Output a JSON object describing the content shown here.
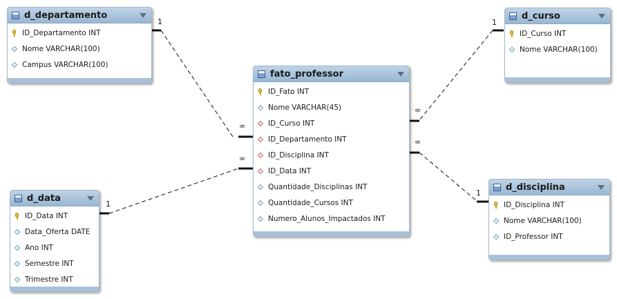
{
  "tables": {
    "d_departamento": {
      "title": "d_departamento",
      "columns": [
        {
          "label": "ID_Departamento INT",
          "kind": "pk"
        },
        {
          "label": "Nome VARCHAR(100)",
          "kind": "attr"
        },
        {
          "label": "Campus VARCHAR(100)",
          "kind": "attr"
        }
      ]
    },
    "d_curso": {
      "title": "d_curso",
      "columns": [
        {
          "label": "ID_Curso INT",
          "kind": "pk"
        },
        {
          "label": "Nome VARCHAR(100)",
          "kind": "attr"
        }
      ]
    },
    "fato_professor": {
      "title": "fato_professor",
      "columns": [
        {
          "label": "ID_Fato INT",
          "kind": "pk"
        },
        {
          "label": "Nome VARCHAR(45)",
          "kind": "attr"
        },
        {
          "label": "ID_Curso INT",
          "kind": "fk"
        },
        {
          "label": "ID_Departamento INT",
          "kind": "fk"
        },
        {
          "label": "ID_Disciplina INT",
          "kind": "fk"
        },
        {
          "label": "ID_Data INT",
          "kind": "fk"
        },
        {
          "label": "Quantidade_Disciplinas INT",
          "kind": "attr"
        },
        {
          "label": "Quantidade_Cursos INT",
          "kind": "attr"
        },
        {
          "label": "Numero_Alunos_Impactados INT",
          "kind": "attr"
        }
      ]
    },
    "d_data": {
      "title": "d_data",
      "columns": [
        {
          "label": "ID_Data INT",
          "kind": "pk"
        },
        {
          "label": "Data_Oferta DATE",
          "kind": "attr"
        },
        {
          "label": "Ano INT",
          "kind": "attr"
        },
        {
          "label": "Semestre INT",
          "kind": "attr"
        },
        {
          "label": "Trimestre INT",
          "kind": "attr"
        }
      ]
    },
    "d_disciplina": {
      "title": "d_disciplina",
      "columns": [
        {
          "label": "ID_Disciplina INT",
          "kind": "pk"
        },
        {
          "label": "Nome VARCHAR(100)",
          "kind": "attr"
        },
        {
          "label": "ID_Professor INT",
          "kind": "attr"
        }
      ]
    }
  },
  "relationships": {
    "departamento": {
      "one_label": "1",
      "many_label": "∞"
    },
    "curso": {
      "one_label": "1",
      "many_label": "∞"
    },
    "data": {
      "one_label": "1",
      "many_label": "∞"
    },
    "disciplina": {
      "one_label": "1",
      "many_label": "∞"
    }
  },
  "icons": {
    "table": "table-icon",
    "primary_key": "key-icon",
    "foreign_key": "foreign-key-diamond-icon",
    "attribute": "attribute-diamond-icon",
    "collapse": "chevron-down-icon"
  },
  "colors": {
    "header": "#a9c4dc",
    "border": "#9fb6cb",
    "key": "#e6c23a",
    "fk_diamond": "#c07070",
    "attr_diamond": "#6fa3b3"
  }
}
